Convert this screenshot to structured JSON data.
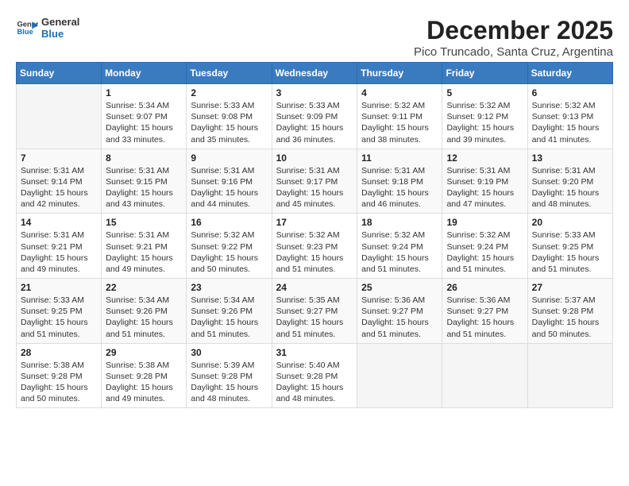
{
  "logo": {
    "line1": "General",
    "line2": "Blue"
  },
  "title": "December 2025",
  "subtitle": "Pico Truncado, Santa Cruz, Argentina",
  "header_days": [
    "Sunday",
    "Monday",
    "Tuesday",
    "Wednesday",
    "Thursday",
    "Friday",
    "Saturday"
  ],
  "weeks": [
    [
      {
        "day": "",
        "info": ""
      },
      {
        "day": "1",
        "info": "Sunrise: 5:34 AM\nSunset: 9:07 PM\nDaylight: 15 hours\nand 33 minutes."
      },
      {
        "day": "2",
        "info": "Sunrise: 5:33 AM\nSunset: 9:08 PM\nDaylight: 15 hours\nand 35 minutes."
      },
      {
        "day": "3",
        "info": "Sunrise: 5:33 AM\nSunset: 9:09 PM\nDaylight: 15 hours\nand 36 minutes."
      },
      {
        "day": "4",
        "info": "Sunrise: 5:32 AM\nSunset: 9:11 PM\nDaylight: 15 hours\nand 38 minutes."
      },
      {
        "day": "5",
        "info": "Sunrise: 5:32 AM\nSunset: 9:12 PM\nDaylight: 15 hours\nand 39 minutes."
      },
      {
        "day": "6",
        "info": "Sunrise: 5:32 AM\nSunset: 9:13 PM\nDaylight: 15 hours\nand 41 minutes."
      }
    ],
    [
      {
        "day": "7",
        "info": "Sunrise: 5:31 AM\nSunset: 9:14 PM\nDaylight: 15 hours\nand 42 minutes."
      },
      {
        "day": "8",
        "info": "Sunrise: 5:31 AM\nSunset: 9:15 PM\nDaylight: 15 hours\nand 43 minutes."
      },
      {
        "day": "9",
        "info": "Sunrise: 5:31 AM\nSunset: 9:16 PM\nDaylight: 15 hours\nand 44 minutes."
      },
      {
        "day": "10",
        "info": "Sunrise: 5:31 AM\nSunset: 9:17 PM\nDaylight: 15 hours\nand 45 minutes."
      },
      {
        "day": "11",
        "info": "Sunrise: 5:31 AM\nSunset: 9:18 PM\nDaylight: 15 hours\nand 46 minutes."
      },
      {
        "day": "12",
        "info": "Sunrise: 5:31 AM\nSunset: 9:19 PM\nDaylight: 15 hours\nand 47 minutes."
      },
      {
        "day": "13",
        "info": "Sunrise: 5:31 AM\nSunset: 9:20 PM\nDaylight: 15 hours\nand 48 minutes."
      }
    ],
    [
      {
        "day": "14",
        "info": "Sunrise: 5:31 AM\nSunset: 9:21 PM\nDaylight: 15 hours\nand 49 minutes."
      },
      {
        "day": "15",
        "info": "Sunrise: 5:31 AM\nSunset: 9:21 PM\nDaylight: 15 hours\nand 49 minutes."
      },
      {
        "day": "16",
        "info": "Sunrise: 5:32 AM\nSunset: 9:22 PM\nDaylight: 15 hours\nand 50 minutes."
      },
      {
        "day": "17",
        "info": "Sunrise: 5:32 AM\nSunset: 9:23 PM\nDaylight: 15 hours\nand 51 minutes."
      },
      {
        "day": "18",
        "info": "Sunrise: 5:32 AM\nSunset: 9:24 PM\nDaylight: 15 hours\nand 51 minutes."
      },
      {
        "day": "19",
        "info": "Sunrise: 5:32 AM\nSunset: 9:24 PM\nDaylight: 15 hours\nand 51 minutes."
      },
      {
        "day": "20",
        "info": "Sunrise: 5:33 AM\nSunset: 9:25 PM\nDaylight: 15 hours\nand 51 minutes."
      }
    ],
    [
      {
        "day": "21",
        "info": "Sunrise: 5:33 AM\nSunset: 9:25 PM\nDaylight: 15 hours\nand 51 minutes."
      },
      {
        "day": "22",
        "info": "Sunrise: 5:34 AM\nSunset: 9:26 PM\nDaylight: 15 hours\nand 51 minutes."
      },
      {
        "day": "23",
        "info": "Sunrise: 5:34 AM\nSunset: 9:26 PM\nDaylight: 15 hours\nand 51 minutes."
      },
      {
        "day": "24",
        "info": "Sunrise: 5:35 AM\nSunset: 9:27 PM\nDaylight: 15 hours\nand 51 minutes."
      },
      {
        "day": "25",
        "info": "Sunrise: 5:36 AM\nSunset: 9:27 PM\nDaylight: 15 hours\nand 51 minutes."
      },
      {
        "day": "26",
        "info": "Sunrise: 5:36 AM\nSunset: 9:27 PM\nDaylight: 15 hours\nand 51 minutes."
      },
      {
        "day": "27",
        "info": "Sunrise: 5:37 AM\nSunset: 9:28 PM\nDaylight: 15 hours\nand 50 minutes."
      }
    ],
    [
      {
        "day": "28",
        "info": "Sunrise: 5:38 AM\nSunset: 9:28 PM\nDaylight: 15 hours\nand 50 minutes."
      },
      {
        "day": "29",
        "info": "Sunrise: 5:38 AM\nSunset: 9:28 PM\nDaylight: 15 hours\nand 49 minutes."
      },
      {
        "day": "30",
        "info": "Sunrise: 5:39 AM\nSunset: 9:28 PM\nDaylight: 15 hours\nand 48 minutes."
      },
      {
        "day": "31",
        "info": "Sunrise: 5:40 AM\nSunset: 9:28 PM\nDaylight: 15 hours\nand 48 minutes."
      },
      {
        "day": "",
        "info": ""
      },
      {
        "day": "",
        "info": ""
      },
      {
        "day": "",
        "info": ""
      }
    ]
  ]
}
